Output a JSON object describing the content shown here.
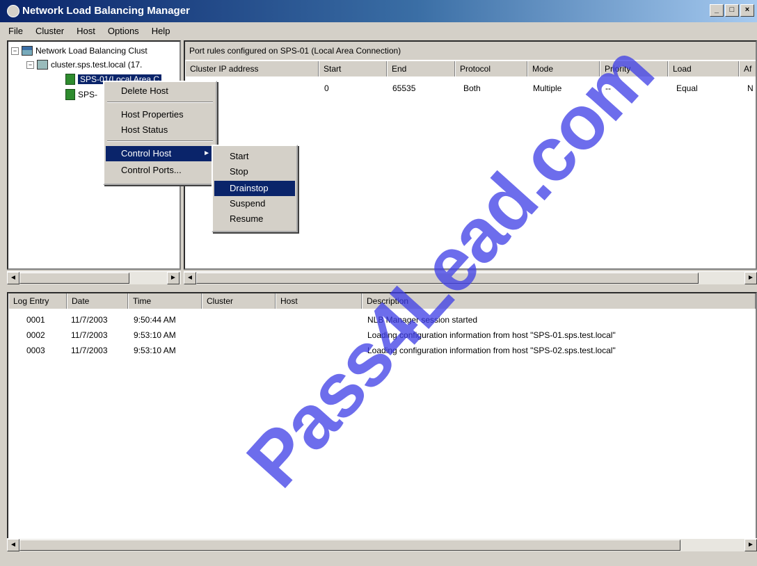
{
  "window": {
    "title": "Network Load Balancing Manager",
    "buttons": [
      "_",
      "□",
      "×"
    ]
  },
  "menubar": [
    "File",
    "Cluster",
    "Host",
    "Options",
    "Help"
  ],
  "tree": {
    "root": "Network Load Balancing Clust",
    "cluster": "cluster.sps.test.local (17.",
    "host1": "SPS-01(Local Area C",
    "host2": "SPS-"
  },
  "right_pane": {
    "header": "Port rules configured on SPS-01 (Local Area Connection)",
    "columns": [
      "Cluster IP address",
      "Start",
      "End",
      "Protocol",
      "Mode",
      "Priority",
      "Load",
      "Af"
    ],
    "row": [
      "",
      "0",
      "65535",
      "Both",
      "Multiple",
      "--",
      "Equal",
      "N"
    ]
  },
  "context_menu": {
    "items": [
      "Delete Host",
      "Host Properties",
      "Host Status",
      "Control Host",
      "Control Ports..."
    ]
  },
  "submenu": {
    "items": [
      "Start",
      "Stop",
      "Drainstop",
      "Suspend",
      "Resume"
    ]
  },
  "log": {
    "columns": [
      "Log Entry",
      "Date",
      "Time",
      "Cluster",
      "Host",
      "Description"
    ],
    "rows": [
      [
        "0001",
        "11/7/2003",
        "9:50:44 AM",
        "",
        "",
        "NLB Manager session started"
      ],
      [
        "0002",
        "11/7/2003",
        "9:53:10 AM",
        "",
        "",
        "Loading configuration information from host \"SPS-01.sps.test.local\""
      ],
      [
        "0003",
        "11/7/2003",
        "9:53:10 AM",
        "",
        "",
        "Loading configuration information from host \"SPS-02.sps.test.local\""
      ]
    ]
  },
  "watermark": "Pass4Lead.com"
}
